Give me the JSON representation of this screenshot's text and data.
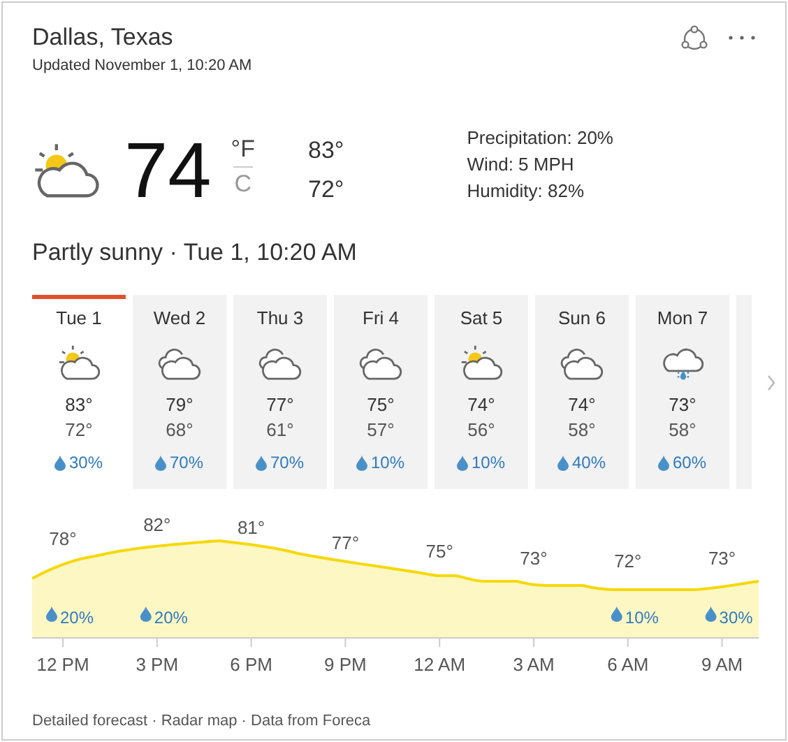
{
  "location": "Dallas, Texas",
  "updated": "Updated November 1, 10:20 AM",
  "current": {
    "kind": "partly-sunny",
    "temperature": "74",
    "units": [
      {
        "label": "°F",
        "selected": true
      },
      {
        "label": "C",
        "selected": false
      }
    ],
    "high": "83°",
    "low": "72°",
    "details": [
      "Precipitation: 20%",
      "Wind: 5 MPH",
      "Humidity: 82%"
    ]
  },
  "summary": "Partly sunny · Tue 1, 10:20 AM",
  "days": [
    {
      "label": "Tue 1",
      "kind": "partly-sunny",
      "high": "83°",
      "low": "72°",
      "precip": "30%",
      "selected": true
    },
    {
      "label": "Wed 2",
      "kind": "cloudy",
      "high": "79°",
      "low": "68°",
      "precip": "70%",
      "selected": false
    },
    {
      "label": "Thu 3",
      "kind": "cloudy",
      "high": "77°",
      "low": "61°",
      "precip": "70%",
      "selected": false
    },
    {
      "label": "Fri 4",
      "kind": "cloudy",
      "high": "75°",
      "low": "57°",
      "precip": "10%",
      "selected": false
    },
    {
      "label": "Sat 5",
      "kind": "partly-sunny",
      "high": "74°",
      "low": "56°",
      "precip": "10%",
      "selected": false
    },
    {
      "label": "Sun 6",
      "kind": "cloudy",
      "high": "74°",
      "low": "58°",
      "precip": "40%",
      "selected": false
    },
    {
      "label": "Mon 7",
      "kind": "rain",
      "high": "73°",
      "low": "58°",
      "precip": "60%",
      "selected": false
    }
  ],
  "hours": [
    {
      "time": "12 PM",
      "temperature": "78°",
      "precip": "20%"
    },
    {
      "time": "3 PM",
      "temperature": "82°",
      "precip": "20%"
    },
    {
      "time": "6 PM",
      "temperature": "81°"
    },
    {
      "time": "9 PM",
      "temperature": "77°"
    },
    {
      "time": "12 AM",
      "temperature": "75°"
    },
    {
      "time": "3 AM",
      "temperature": "73°"
    },
    {
      "time": "6 AM",
      "temperature": "72°",
      "precip": "10%"
    },
    {
      "time": "9 AM",
      "temperature": "73°",
      "precip": "30%"
    }
  ],
  "footer": "Detailed forecast · Radar map · Data from Foreca"
}
